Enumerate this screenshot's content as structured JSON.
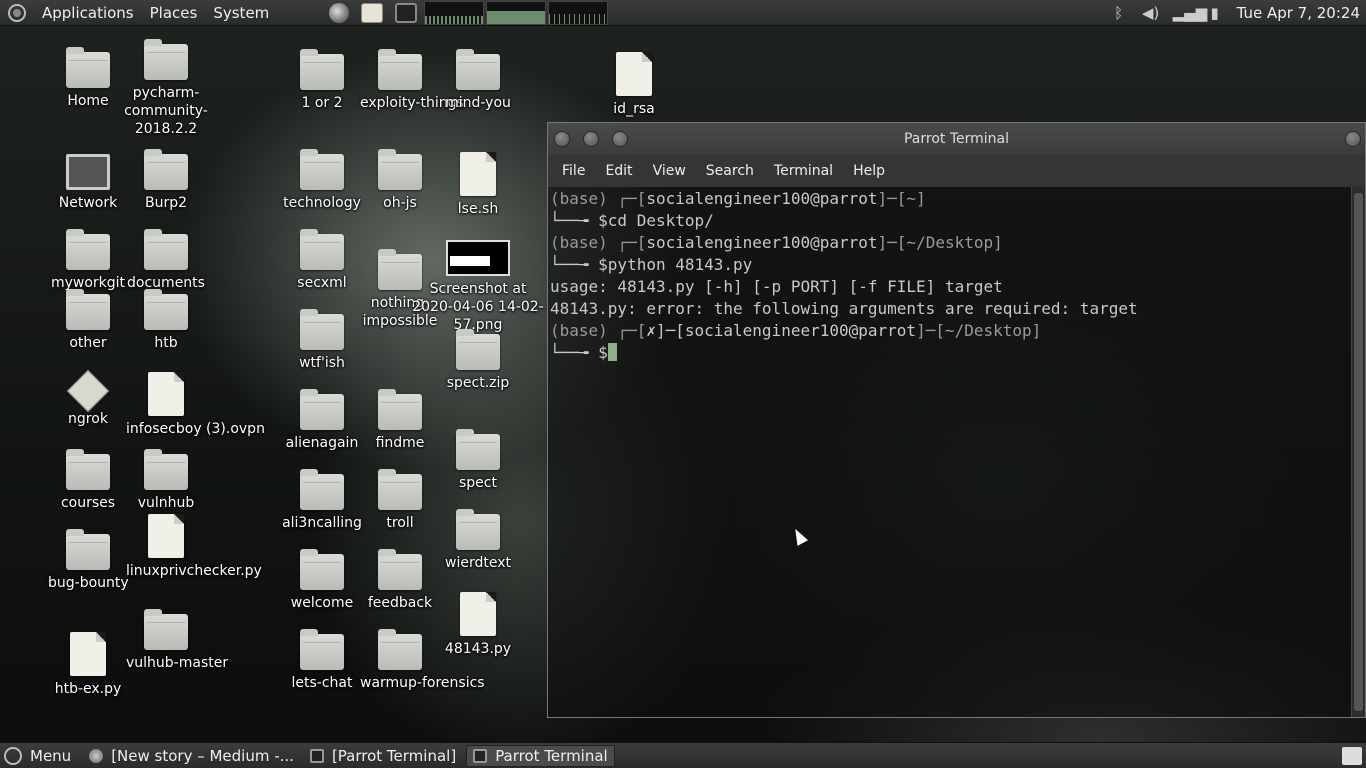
{
  "top_panel": {
    "menus": [
      "Applications",
      "Places",
      "System"
    ],
    "clock": "Tue Apr 7, 20:24"
  },
  "desktop_icons": [
    {
      "label": "Home",
      "type": "folder-home"
    },
    {
      "label": "pycharm-community-2018.2.2",
      "type": "folder"
    },
    {
      "label": "Network",
      "type": "computer"
    },
    {
      "label": "Burp2",
      "type": "folder"
    },
    {
      "label": "myworkgit",
      "type": "folder"
    },
    {
      "label": "documents",
      "type": "folder"
    },
    {
      "label": "other",
      "type": "folder"
    },
    {
      "label": "htb",
      "type": "folder"
    },
    {
      "label": "ngrok",
      "type": "executable"
    },
    {
      "label": "infosecboy (3).ovpn",
      "type": "file"
    },
    {
      "label": "courses",
      "type": "folder"
    },
    {
      "label": "vulnhub",
      "type": "folder"
    },
    {
      "label": "bug-bounty",
      "type": "folder"
    },
    {
      "label": "linuxprivchecker.py",
      "type": "file"
    },
    {
      "label": "htb-ex.py",
      "type": "file"
    },
    {
      "label": "vulhub-master",
      "type": "folder"
    },
    {
      "label": "1 or 2",
      "type": "folder"
    },
    {
      "label": "exploity-things",
      "type": "folder"
    },
    {
      "label": "mind-you",
      "type": "folder"
    },
    {
      "label": "id_rsa",
      "type": "file"
    },
    {
      "label": "technology",
      "type": "folder"
    },
    {
      "label": "oh-js",
      "type": "folder"
    },
    {
      "label": "lse.sh",
      "type": "script"
    },
    {
      "label": "secxml",
      "type": "folder"
    },
    {
      "label": "nothing-impossible",
      "type": "folder"
    },
    {
      "label": "Screenshot at 2020-04-06 14-02-57.png",
      "type": "image"
    },
    {
      "label": "wtf'ish",
      "type": "folder"
    },
    {
      "label": "spect.zip",
      "type": "archive"
    },
    {
      "label": "alienagain",
      "type": "folder"
    },
    {
      "label": "findme",
      "type": "folder"
    },
    {
      "label": "spect",
      "type": "folder"
    },
    {
      "label": "ali3ncalling",
      "type": "folder"
    },
    {
      "label": "troll",
      "type": "folder"
    },
    {
      "label": "wierdtext",
      "type": "folder"
    },
    {
      "label": "welcome",
      "type": "folder"
    },
    {
      "label": "feedback",
      "type": "folder"
    },
    {
      "label": "48143.py",
      "type": "file"
    },
    {
      "label": "lets-chat",
      "type": "folder"
    },
    {
      "label": "warmup-forensics",
      "type": "folder"
    }
  ],
  "terminal": {
    "title": "Parrot Terminal",
    "menu": [
      "File",
      "Edit",
      "View",
      "Search",
      "Terminal",
      "Help"
    ],
    "lines": [
      {
        "dim": "(base) ┌─[",
        "user": "socialengineer100",
        "at": "@",
        "host": "parrot",
        "dim2": "]─[~]"
      },
      {
        "text": "└──╼ $cd Desktop/"
      },
      {
        "dim": "(base) ┌─[",
        "user": "socialengineer100",
        "at": "@",
        "host": "parrot",
        "dim2": "]─[~/Desktop]"
      },
      {
        "text": "└──╼ $python 48143.py"
      },
      {
        "text": "usage: 48143.py [-h] [-p PORT] [-f FILE] target"
      },
      {
        "text": "48143.py: error: the following arguments are required: target"
      },
      {
        "dim": "(base) ┌─[",
        "user": "✗]─[socialengineer100",
        "at": "@",
        "host": "parrot",
        "dim2": "]─[~/Desktop]"
      },
      {
        "text": "└──╼ $"
      }
    ]
  },
  "bottom_panel": {
    "menu_label": "Menu",
    "tasks": [
      "[New story – Medium -...",
      "[Parrot Terminal]",
      "Parrot Terminal"
    ]
  }
}
